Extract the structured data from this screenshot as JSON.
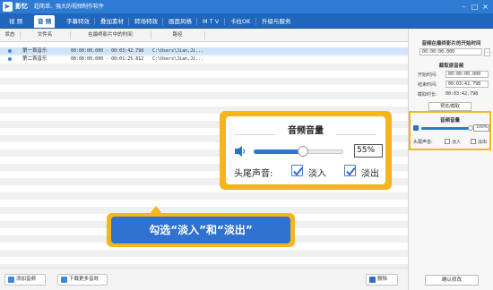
{
  "app": {
    "name": "影忆",
    "slogan": "超简单、强大的视频制作软件"
  },
  "window_controls": {
    "minimize": "–",
    "maximize": "□",
    "close": "×"
  },
  "tabs": [
    {
      "label": "视 频",
      "active": false
    },
    {
      "label": "音 频",
      "active": true
    },
    {
      "label": "字幕特效",
      "active": false
    },
    {
      "label": "叠加素材",
      "active": false
    },
    {
      "label": "转场特效",
      "active": false
    },
    {
      "label": "画面风格",
      "active": false
    },
    {
      "label": "M T V",
      "active": false
    },
    {
      "label": "卡拉OK",
      "active": false
    },
    {
      "label": "升级与服务",
      "active": false
    }
  ],
  "list": {
    "columns": [
      "状态",
      "文件名",
      "在最终影片中的时间",
      "路径"
    ],
    "rows": [
      {
        "name": "第一首音乐",
        "time": "00:00:00.000 - 00:03:42.798",
        "path": "C:\\Users\\Jian,Ji...",
        "selected": true
      },
      {
        "name": "第二首音乐",
        "time": "00:00:00.000 - 00:01:25.812",
        "path": "C:\\Users\\Jian,Ji...",
        "selected": false
      }
    ]
  },
  "bottom_bar": {
    "add_audio": "添加音频",
    "download_more": "下载更多音效",
    "delete": "删除"
  },
  "right_panel": {
    "start_time_title": "音频在最终影片的开始时间",
    "start_time_value": "00:00:00.000",
    "clip_title": "截取原音频",
    "start_label": "开始时间:",
    "start_value": "00:00:00.000",
    "end_label": "结束时间:",
    "end_value": "00:03:42.798",
    "duration_label": "截取时长:",
    "duration_value": "00:03:42.798",
    "preview_button": "预览/截取",
    "volume_title": "音频音量",
    "volume_value": "100%",
    "volume_level": 1.0,
    "fade_label": "头尾声音:",
    "fade_in": "淡入",
    "fade_out": "淡出",
    "confirm_button": "确认修改"
  },
  "callout": {
    "title": "音频音量",
    "volume_value": "55%",
    "volume_level": 0.55,
    "fade_label": "头尾声音:",
    "fade_in": "淡入",
    "fade_out": "淡出",
    "fade_in_checked": true,
    "fade_out_checked": true
  },
  "banner": {
    "text": "勾选“淡入”和“淡出”"
  },
  "colors": {
    "title_blue": "#2e7bd4",
    "tab_blue": "#2066bb",
    "highlight": "#f5b51b",
    "banner_blue": "#2f72cf"
  }
}
